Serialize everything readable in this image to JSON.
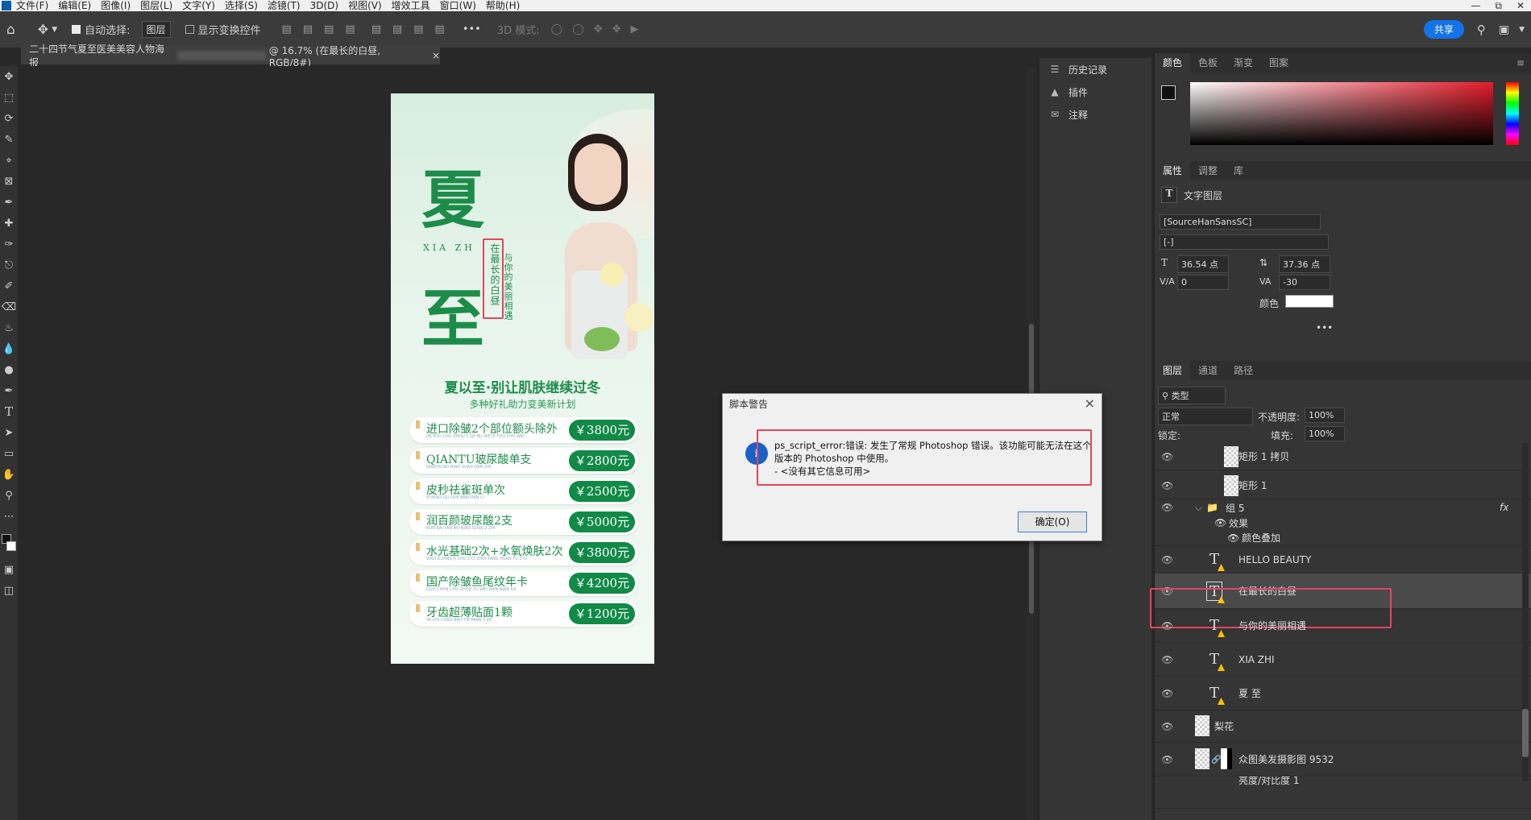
{
  "menubar": {
    "items": [
      "文件(F)",
      "编辑(E)",
      "图像(I)",
      "图层(L)",
      "文字(Y)",
      "选择(S)",
      "滤镜(T)",
      "3D(D)",
      "视图(V)",
      "增效工具",
      "窗口(W)",
      "帮助(H)"
    ]
  },
  "options": {
    "auto_select_label": "自动选择:",
    "auto_select_value": "图层",
    "show_transform_label": "显示变换控件",
    "mode_3d_label": "3D 模式:",
    "more": "•••",
    "share_label": "共享"
  },
  "document": {
    "tab_title_left": "二十四节气夏至医美美容人物海报",
    "tab_title_right": "@ 16.7% (在最长的白昼, RGB/8#)",
    "close_glyph": "×"
  },
  "poster": {
    "char_top": "夏",
    "char_bottom": "至",
    "pinyin": "XIA ZH",
    "vertical_1": "在最长的白昼",
    "vertical_2": "与你的美丽相遇",
    "headline": "夏以至·别让肌肤继续过冬",
    "subline": "多种好礼助力变美新计划",
    "items": [
      {
        "name": "进口除皱2个部位额头除外",
        "sub": "JIN KOU CHU ZHOU 2 GE BU WEI E TOU CHU WAI",
        "price": "￥3800元"
      },
      {
        "name": "QIANTU玻尿酸单支",
        "sub": "QIANTU BO NIAO SUAN DAN ZHI",
        "price": "￥2800元"
      },
      {
        "name": "皮秒祛雀斑单次",
        "sub": "PI MIAO QU QUE BAN DAN CI",
        "price": "￥2500元"
      },
      {
        "name": "润百颜玻尿酸2支",
        "sub": "RUN BAI YAN BO NIAO SUAN 2 ZHI",
        "price": "￥5000元"
      },
      {
        "name": "水光基础2次+水氧焕肤2次",
        "sub": "SHUI GUANG JI CHU 2 CI SHUI YANG HUAN FU 2 CI",
        "price": "￥3800元"
      },
      {
        "name": "国产除皱鱼尾纹年卡",
        "sub": "GUO CHAN CHU ZHOU YU WEI WEN NIAN KA",
        "price": "￥4200元"
      },
      {
        "name": "牙齿超薄贴面1颗",
        "sub": "YA CHI CHAO BAO TIE MIAN 1 KE",
        "price": "￥1200元"
      }
    ]
  },
  "mini_panel": {
    "items": [
      {
        "label": "历史记录",
        "icon": "history-icon"
      },
      {
        "label": "插件",
        "icon": "plugin-icon"
      },
      {
        "label": "注释",
        "icon": "comment-icon"
      }
    ]
  },
  "color_panel": {
    "tabs": [
      "颜色",
      "色板",
      "渐变",
      "图案"
    ]
  },
  "properties": {
    "tabs": [
      "属性",
      "调整",
      "库"
    ],
    "type_label": "文字图层",
    "font_family": "[SourceHanSansSC]",
    "font_style": "[-]",
    "font_size": "36.54 点",
    "leading": "37.36 点",
    "kerning": "0",
    "tracking": "-30",
    "color_label": "颜色",
    "text_color": "#ffffff",
    "more": "•••"
  },
  "layers_panel": {
    "tabs": [
      "图层",
      "通道",
      "路径"
    ],
    "filter_label": "类型",
    "blend_mode": "正常",
    "opacity_label": "不透明度:",
    "opacity": "100%",
    "lock_label": "锁定:",
    "fill_label": "填充:",
    "fill": "100%",
    "layers": [
      {
        "name": "矩形 1 拷贝",
        "kind": "shape"
      },
      {
        "name": "矩形 1",
        "kind": "shape"
      },
      {
        "name": "组 5",
        "kind": "group",
        "fx": "fx"
      },
      {
        "name": "效果",
        "kind": "effect"
      },
      {
        "name": "颜色叠加",
        "kind": "effect"
      },
      {
        "name": "HELLO BEAUTY",
        "kind": "text"
      },
      {
        "name": "在最长的白昼",
        "kind": "text",
        "selected": true
      },
      {
        "name": "与你的美丽相遇",
        "kind": "text"
      },
      {
        "name": "XIA ZHI",
        "kind": "text"
      },
      {
        "name": "夏 至",
        "kind": "text"
      },
      {
        "name": "梨花",
        "kind": "image"
      },
      {
        "name": "众图美发摄影图 9532",
        "kind": "image"
      },
      {
        "name": "亮度/对比度 1",
        "kind": "adjustment"
      }
    ]
  },
  "dialog": {
    "title": "脚本警告",
    "message_line1": "ps_script_error:错误: 发生了常规 Photoshop 错误。该功能可能无法在这个",
    "message_line2": "版本的 Photoshop 中使用。",
    "message_line3": "- <没有其它信息可用>",
    "ok_label": "确定(O)",
    "close_glyph": "×",
    "info_glyph": "i"
  },
  "colors": {
    "accent": "#1473e6",
    "highlight": "#e3455d",
    "poster_green": "#1d8c4a",
    "selected_layer": "#4a4a4a"
  }
}
